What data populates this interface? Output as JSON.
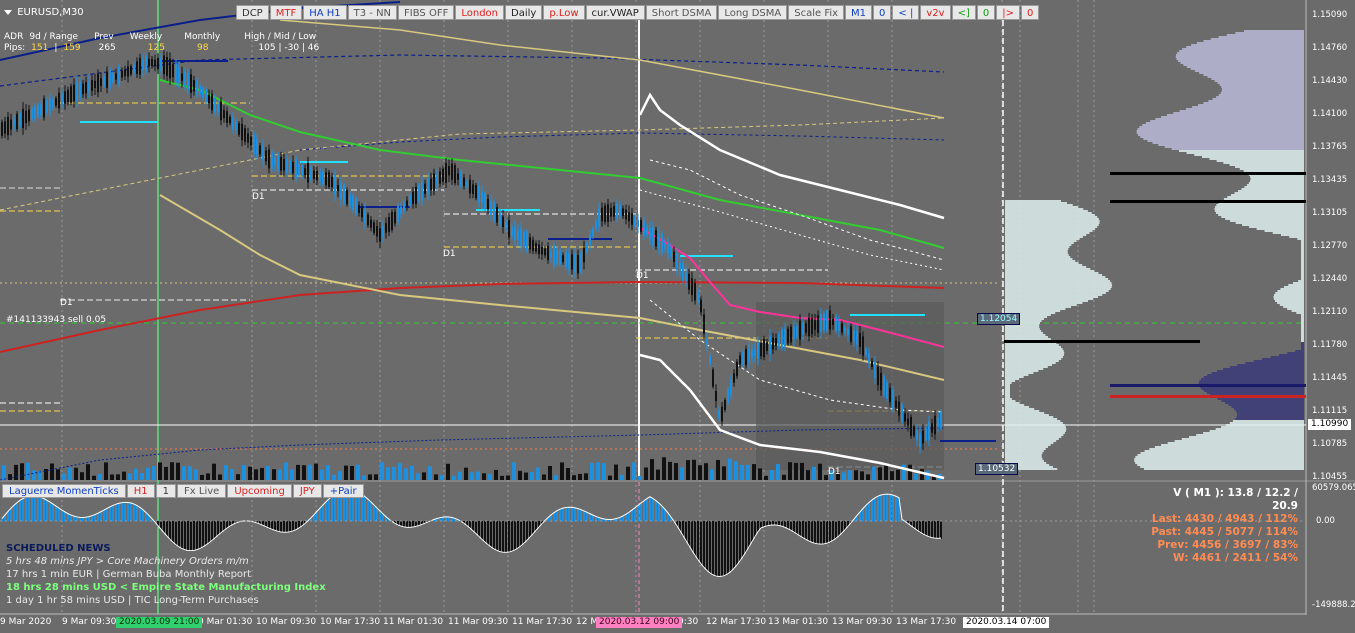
{
  "header": {
    "symbol": "EURUSD,M30"
  },
  "toolbar": {
    "buttons": [
      {
        "label": "DCP",
        "color": "#333333"
      },
      {
        "label": "MTF",
        "color": "#e02020"
      },
      {
        "label": "HA H1",
        "color": "#1040c0"
      },
      {
        "label": "T3 - NN",
        "color": "#555555"
      },
      {
        "label": "FIBS OFF",
        "color": "#555555"
      },
      {
        "label": "London",
        "color": "#e02020"
      },
      {
        "label": "Daily",
        "color": "#222222"
      },
      {
        "label": "p.Low",
        "color": "#e02020"
      },
      {
        "label": "cur.VWAP",
        "color": "#222222"
      },
      {
        "label": "Short DSMA",
        "color": "#555555"
      },
      {
        "label": "Long DSMA",
        "color": "#555555"
      },
      {
        "label": "Scale Fix",
        "color": "#555555"
      },
      {
        "label": "M1",
        "color": "#1040c0"
      },
      {
        "label": "0",
        "color": "#1040c0"
      },
      {
        "label": "< |",
        "color": "#1040c0"
      },
      {
        "label": "v2v",
        "color": "#e02020"
      },
      {
        "label": "<]",
        "color": "#10a010"
      },
      {
        "label": "0",
        "color": "#10a010"
      },
      {
        "label": "|>",
        "color": "#e02020"
      },
      {
        "label": "0",
        "color": "#e02020"
      }
    ]
  },
  "stats": {
    "adr_label": "ADR",
    "range_label": "9d / Range",
    "prev_label": "Prev",
    "weekly_label": "Weekly",
    "monthly_label": "Monthly",
    "hml_label": "High / Mid / Low",
    "pips_label": "Pips:",
    "adr_value": "151",
    "range_value": "159",
    "prev_value": "265",
    "weekly_value": "125",
    "monthly_value": "98",
    "hml_value": "105  |  -30  |  46"
  },
  "price_axis": [
    "1.15090",
    "1.14760",
    "1.14430",
    "1.14100",
    "1.13765",
    "1.13435",
    "1.13105",
    "1.12770",
    "1.12440",
    "1.12110",
    "1.11780",
    "1.11445",
    "1.11115",
    "1.10785",
    "1.10455"
  ],
  "current_price": "1.10990",
  "osc_axis": {
    "top": "60579.065",
    "zero": "0.00",
    "bottom": "-149888.273"
  },
  "time_axis": [
    "9 Mar 2020",
    "9 Mar 09:30",
    "0 Mar 01:30",
    "10 Mar 09:30",
    "10 Mar 17:30",
    "11 Mar 01:30",
    "11 Mar 09:30",
    "11 Mar 17:30",
    "12 M",
    "9:30",
    "12 Mar 17:30",
    "13 Mar 01:30",
    "13 Mar 09:30",
    "13 Mar 17:30"
  ],
  "date_labels": [
    {
      "text": "2020.03.09 21:00",
      "bg": "#30d070",
      "fg": "#003000"
    },
    {
      "text": "2020.03.12 09:00",
      "bg": "#ff80c0",
      "fg": "#400020"
    },
    {
      "text": "2020.03.14 07:00",
      "bg": "#ffffff",
      "fg": "#000000"
    }
  ],
  "trade_label": "#141133943 sell 0.05",
  "d1_labels": [
    "D1",
    "D1",
    "D1",
    "D1",
    "D1"
  ],
  "box_labels": [
    "1.12054",
    "1.10532"
  ],
  "indicator_toolbar": [
    {
      "label": "Laguerre MomenTicks",
      "color": "#1040c0"
    },
    {
      "label": "H1",
      "color": "#e02020"
    },
    {
      "label": "1",
      "color": "#333333"
    },
    {
      "label": "Fx Live",
      "color": "#555555"
    },
    {
      "label": "Upcoming",
      "color": "#e02020"
    },
    {
      "label": "JPY",
      "color": "#e02020"
    },
    {
      "label": "+Pair",
      "color": "#1040c0"
    }
  ],
  "news": {
    "title": "SCHEDULED NEWS",
    "items": [
      {
        "text": "5 hrs 48 mins  JPY  >  Core Machinery Orders m/m",
        "color": "#e8e8e8",
        "italic": true,
        "bold": false
      },
      {
        "text": "17 hrs 1 min  EUR  |  German Buba Monthly Report",
        "color": "#e8e8e8",
        "italic": false,
        "bold": false
      },
      {
        "text": "18 hrs 28 mins  USD  <  Empire State Manufacturing Index",
        "color": "#7dff7d",
        "italic": false,
        "bold": true
      },
      {
        "text": "1 day 1 hr 58 mins  USD  |  TIC Long-Term Purchases",
        "color": "#e8e8e8",
        "italic": false,
        "bold": false
      }
    ]
  },
  "volume": {
    "title": "V ( M1 ): 13.8 / 12.2 / 20.9",
    "rows": [
      "Last: 4430 / 4943 / 112%",
      "Past: 4445 / 5077 / 114%",
      "Prev: 4456 / 3697 / 83%",
      "W: 4461 / 2411 / 54%"
    ]
  },
  "colors": {
    "bg": "#6b6b6b",
    "bull": "#1e90e0",
    "bear": "#111111",
    "ema_green": "#33cc33",
    "ema_red": "#cc2222",
    "ema_khaki": "#d8c880",
    "vwap_pink": "#ff3399"
  }
}
